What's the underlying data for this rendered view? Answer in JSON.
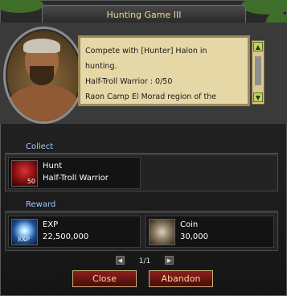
{
  "window": {
    "title": "Hunting Game III"
  },
  "quest": {
    "lines": [
      "Compete with [Hunter] Halon in",
      "hunting.",
      "Half-Troll Warrior : 0/50",
      "Raon Camp El Morad region of the"
    ]
  },
  "collect": {
    "label": "Collect",
    "item": {
      "name": "Hunt",
      "target": "Half-Troll Warrior",
      "count": "50"
    }
  },
  "reward": {
    "label": "Reward",
    "items": [
      {
        "name": "EXP",
        "value": "22,500,000",
        "icon_label": "EXP"
      },
      {
        "name": "Coin",
        "value": "30,000"
      }
    ]
  },
  "pager": {
    "text": "1/1"
  },
  "buttons": {
    "close": "Close",
    "abandon": "Abandon"
  },
  "icons": {
    "prev": "arrow-left-icon",
    "next": "arrow-right-icon",
    "scroll_up": "arrow-up-icon",
    "scroll_down": "arrow-down-icon",
    "hunt": "hunt-icon",
    "exp": "exp-icon",
    "coin": "coin-icon"
  },
  "colors": {
    "title": "#f2d79a",
    "section_label": "#a5c8ff",
    "button_bg": "#8c1f1f",
    "button_text": "#ffd98f",
    "parchment": "#e6d7a6"
  }
}
